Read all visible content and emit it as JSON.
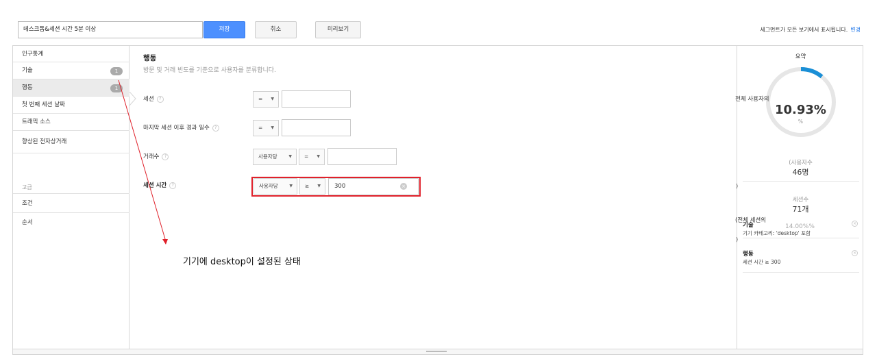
{
  "toolbar": {
    "segment_name": "데스크톱&세션 시간 5분 이상",
    "save_label": "저장",
    "cancel_label": "취소",
    "preview_label": "미리보기",
    "visibility_note": "세그먼트가 모든 보기에서 표시됩니다.",
    "change_link": "변경"
  },
  "sidebar": {
    "items": [
      {
        "label": "인구통계",
        "badge": ""
      },
      {
        "label": "기술",
        "badge": "1"
      },
      {
        "label": "행동",
        "badge": "1"
      },
      {
        "label": "첫 번째 세션 날짜",
        "badge": ""
      },
      {
        "label": "트래픽 소스",
        "badge": ""
      },
      {
        "label": "향상된 전자상거래",
        "badge": ""
      }
    ],
    "advanced_label": "고급",
    "advanced_items": [
      {
        "label": "조건"
      },
      {
        "label": "순서"
      }
    ]
  },
  "main": {
    "title": "행동",
    "description": "방문 및 거래 빈도를 기준으로 사용자를 분류합니다.",
    "help_glyph": "?",
    "rows": [
      {
        "label": "세션",
        "operator": "=",
        "value": ""
      },
      {
        "label": "마지막 세션 이후 경과 일수",
        "operator": "=",
        "value": ""
      },
      {
        "label": "거래수",
        "scope": "사용자당",
        "operator": "=",
        "value": ""
      },
      {
        "label": "세션 시간",
        "scope": "사용자당",
        "operator": "≥",
        "value": "300"
      }
    ],
    "annotation": "기기에 desktop이 설정된 상태",
    "annotation_color": "#e0202a"
  },
  "summary": {
    "title": "요약",
    "users_prefix": "전체 사용자의",
    "users_pct": "10.93%",
    "users_pct_unit": "%",
    "users_fraction": 0.1093,
    "users_label": "(사용자수",
    "users_value": "46명",
    "close_paren": ")",
    "sessions_label": "세션수",
    "sessions_value": "71개",
    "sessions_prefix": "(전체 세션의",
    "sessions_pct": "14.00%%",
    "conditions": [
      {
        "title": "기술",
        "desc": "기기 카테고리: 'desktop' 포함"
      },
      {
        "title": "행동",
        "desc": "세션 시간 ≥ 300"
      }
    ],
    "ring_color": "#1a8fd6"
  }
}
